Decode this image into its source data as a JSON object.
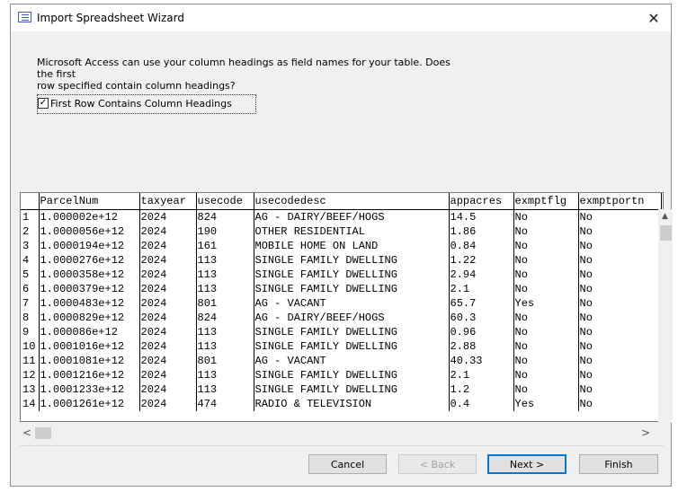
{
  "window": {
    "title": "Import Spreadsheet Wizard",
    "close_glyph": "✕"
  },
  "description": {
    "line1": "Microsoft Access can use your column headings as field names for your table. Does the first",
    "line2": "row specified contain column headings?"
  },
  "checkbox": {
    "label": "First Row Contains Column Headings",
    "checked": true,
    "mark": "✓"
  },
  "grid": {
    "columns": [
      "ParcelNum",
      "taxyear",
      "usecode",
      "usecodedesc",
      "appacres",
      "exmptflg",
      "exmptportn"
    ],
    "row_numbers": [
      "1",
      "2",
      "3",
      "4",
      "5",
      "6",
      "7",
      "8",
      "9",
      "10",
      "11",
      "12",
      "13",
      "14"
    ],
    "rows": [
      [
        "1.000002e+12",
        "2024",
        "824",
        "AG - DAIRY/BEEF/HOGS",
        "14.5",
        "No",
        "No"
      ],
      [
        "1.0000056e+12",
        "2024",
        "190",
        "OTHER RESIDENTIAL",
        "1.86",
        "No",
        "No"
      ],
      [
        "1.0000194e+12",
        "2024",
        "161",
        "MOBILE HOME ON LAND",
        "0.84",
        "No",
        "No"
      ],
      [
        "1.0000276e+12",
        "2024",
        "113",
        "SINGLE FAMILY DWELLING",
        "1.22",
        "No",
        "No"
      ],
      [
        "1.0000358e+12",
        "2024",
        "113",
        "SINGLE FAMILY DWELLING",
        "2.94",
        "No",
        "No"
      ],
      [
        "1.0000379e+12",
        "2024",
        "113",
        "SINGLE FAMILY DWELLING",
        "2.1",
        "No",
        "No"
      ],
      [
        "1.0000483e+12",
        "2024",
        "801",
        "AG - VACANT",
        "65.7",
        "Yes",
        "No"
      ],
      [
        "1.0000829e+12",
        "2024",
        "824",
        "AG - DAIRY/BEEF/HOGS",
        "60.3",
        "No",
        "No"
      ],
      [
        "1.000086e+12",
        "2024",
        "113",
        "SINGLE FAMILY DWELLING",
        "0.96",
        "No",
        "No"
      ],
      [
        "1.0001016e+12",
        "2024",
        "113",
        "SINGLE FAMILY DWELLING",
        "2.88",
        "No",
        "No"
      ],
      [
        "1.0001081e+12",
        "2024",
        "801",
        "AG - VACANT",
        "40.33",
        "No",
        "No"
      ],
      [
        "1.0001216e+12",
        "2024",
        "113",
        "SINGLE FAMILY DWELLING",
        "2.1",
        "No",
        "No"
      ],
      [
        "1.0001233e+12",
        "2024",
        "113",
        "SINGLE FAMILY DWELLING",
        "1.2",
        "No",
        "No"
      ],
      [
        "1.0001261e+12",
        "2024",
        "474",
        "RADIO & TELEVISION",
        "0.4",
        "Yes",
        "No"
      ]
    ]
  },
  "scroll": {
    "up": "▲",
    "left": "<",
    "right": ">"
  },
  "buttons": {
    "cancel": "Cancel",
    "back": "< Back",
    "next": "Next >",
    "finish": "Finish"
  }
}
